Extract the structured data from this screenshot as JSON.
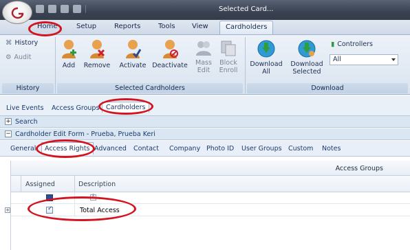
{
  "window": {
    "title": "Selected Card..."
  },
  "ribbon_tabs": [
    "Home",
    "Setup",
    "Reports",
    "Tools",
    "View",
    "Cardholders"
  ],
  "ribbon": {
    "history_group": {
      "history": "History",
      "audit": "Audit",
      "label": "History"
    },
    "selected_group": {
      "label": "Selected Cardholders",
      "add": "Add",
      "remove": "Remove",
      "activate": "Activate",
      "deactivate": "Deactivate",
      "mass_edit_1": "Mass",
      "mass_edit_2": "Edit",
      "block_enroll_1": "Block",
      "block_enroll_2": "Enroll"
    },
    "download_group": {
      "label": "Download",
      "download_all_1": "Download",
      "download_all_2": "All",
      "download_selected_1": "Download",
      "download_selected_2": "Selected",
      "controllers": "Controllers",
      "controllers_value": "All"
    }
  },
  "nav_tabs": [
    "Live Events",
    "Access Groups",
    "Cardholders"
  ],
  "expanders": {
    "search": {
      "sign": "+",
      "label": "Search"
    },
    "edit_form": {
      "sign": "−",
      "label": "Cardholder Edit Form - Prueba, Prueba Keri"
    }
  },
  "sub_tabs": [
    "General",
    "Access Rights",
    "Advanced",
    "Contact",
    "Company",
    "Photo ID",
    "User Groups",
    "Custom",
    "Notes"
  ],
  "grid": {
    "group_header": "Access Groups",
    "columns": [
      "Assigned",
      "Description"
    ],
    "rows": [
      {
        "assigned": true,
        "description": "Total Access"
      }
    ]
  },
  "colors": {
    "highlight": "#d3131f",
    "ribbon_accent": "#15284b",
    "link": "#1a3a6c"
  }
}
